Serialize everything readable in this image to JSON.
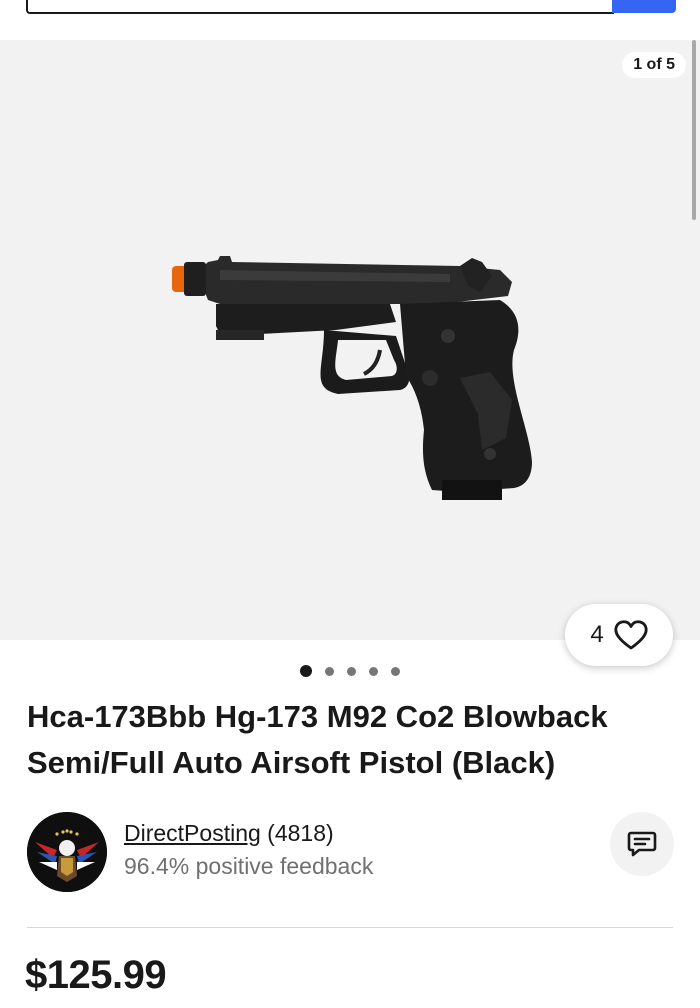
{
  "gallery": {
    "counter": "1 of 5",
    "dots_total": 5,
    "active_dot": 1,
    "background": "#f2f2f2",
    "image_icon": "pistol-product-image"
  },
  "watch": {
    "count": "4",
    "icon": "heart-icon"
  },
  "listing": {
    "title": "Hca-173Bbb Hg-173 M92 Co2 Blowback Semi/Full Auto Airsoft Pistol (Black)",
    "price": "$125.99"
  },
  "seller": {
    "name": "DirectPosting",
    "rating_count": "(4818)",
    "feedback": "96.4% positive feedback",
    "avatar_icon": "eagle-logo-avatar",
    "message_icon": "message-icon"
  },
  "colors": {
    "accent": "#3665f3",
    "text": "#191919",
    "muted": "#707070"
  }
}
